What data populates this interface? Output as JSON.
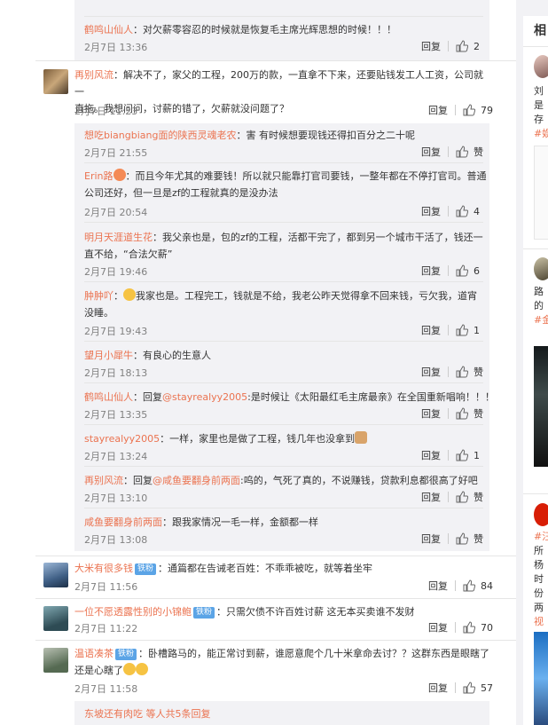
{
  "sidebar": {
    "title": "相",
    "line1": "刘",
    "line2": "是",
    "line3": "存",
    "tag1": "#娱",
    "line4": "路",
    "line5": "的",
    "tag2": "#金",
    "tag3": "#汪",
    "line6": "所",
    "line7": "杨",
    "line8": "时",
    "line9": "份",
    "line10": "两",
    "tag4": "视"
  },
  "actions": {
    "reply": "回复",
    "like_zero": "赞"
  },
  "comments": [
    {
      "user": "鹤鸣山仙人",
      "text": "：对欠薪零容忍的时候就是恢复毛主席光辉思想的时候！！！",
      "date": "2月7日 13:36",
      "likes": "2"
    },
    {
      "user": "再别风流",
      "text_l1": "：解决不了，家父的工程，200万的款，一直拿不下来，还要贴钱发工人工资，公司就一",
      "text_l2": "直拖。我想问问，讨薪的错了，欠薪就没问题了？",
      "date": "2月7日 11:23",
      "likes": "79"
    },
    {
      "user": "想吃biangbiang面的陕西灵魂老农",
      "text": "：害 有时候想要现钱还得扣百分之二十呢",
      "date": "2月7日 21:55",
      "likes": "赞"
    },
    {
      "user": "Erin路",
      "text_l1": "：而且今年尤其的难要钱！所以就只能靠打官司要钱，一整年都在不停打官司。普通",
      "text_l2": "公司还好，但一旦是zf的工程就真的是没办法",
      "date": "2月7日 20:54",
      "likes": "4"
    },
    {
      "user": "明月天涯道生花",
      "text_l1": "：我父亲也是，包的zf的工程，活都干完了，都到另一个城市干活了，钱还一",
      "text_l2": "直不给，“合法欠薪”",
      "date": "2月7日 19:46",
      "likes": "6"
    },
    {
      "user": "肿肿吖",
      "text_l1": "我家也是。工程完工，钱就是不给，我老公昨天觉得拿不回来钱，亏欠我，道宵",
      "text_l2": "没睡。",
      "date": "2月7日 19:43",
      "likes": "1"
    },
    {
      "user": "望月小犀牛",
      "text": "：有良心的生意人",
      "date": "2月7日 18:13",
      "likes": "赞"
    },
    {
      "user": "鹤鸣山仙人",
      "pre": "：回复",
      "mention": "@stayrealyy2005",
      "text": ":是时候让《太阳最红毛主席最亲》在全国重新唱响！！！",
      "date": "2月7日 13:35",
      "likes": "赞"
    },
    {
      "user": "stayrealyy2005",
      "text": "：一样，家里也是做了工程，钱几年也没拿到",
      "date": "2月7日 13:24",
      "likes": "1"
    },
    {
      "user": "再别风流",
      "pre": "：回复",
      "mention": "@咸鱼要翻身前两面",
      "text": ":呜的，气死了真的，不说赚钱，贷款利息都很高了好吧",
      "date": "2月7日 13:10",
      "likes": "赞"
    },
    {
      "user": "咸鱼要翻身前两面",
      "text": "：跟我家情况一毛一样，金额都一样",
      "date": "2月7日 13:08",
      "likes": "赞"
    },
    {
      "user": "大米有很多钱",
      "badge": "铁粉",
      "text": "：通篇都在告诫老百姓：不乖乖被吃，就等着坐牢",
      "date": "2月7日 11:56",
      "likes": "84"
    },
    {
      "user": "一位不愿透露性别的小锦鲍",
      "badge": "铁粉",
      "text": "：只需欠债不许百姓讨薪 这无本买卖谁不发财",
      "date": "2月7日 11:22",
      "likes": "70"
    },
    {
      "user": "温语凑茶",
      "badge": "铁粉",
      "text_l1": "：卧槽路马的，能正常讨到薪，谁愿意爬个几十米拿命去讨？？这群东西是眼瞎了",
      "text_l2": "还是心瞎了",
      "date": "2月7日 11:58",
      "likes": "57"
    }
  ],
  "more": {
    "users": "东坡还有肉吃 等人",
    "count": "共5条回复"
  }
}
